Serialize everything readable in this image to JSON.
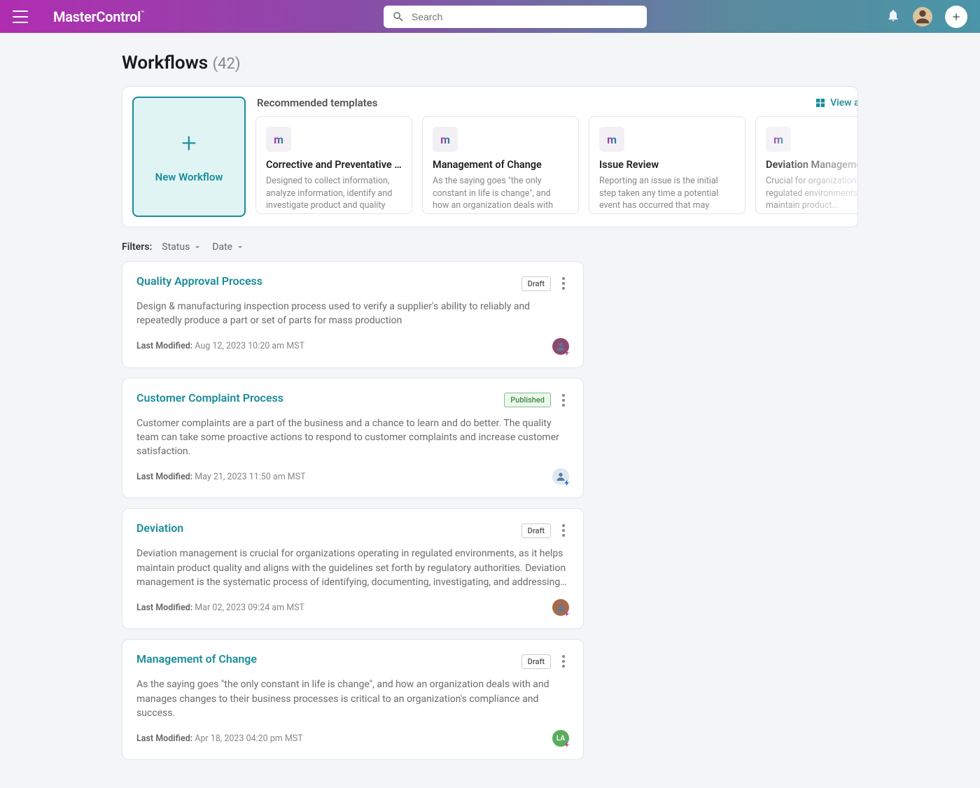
{
  "header": {
    "brand": "MasterControl",
    "search_placeholder": "Search"
  },
  "page": {
    "title": "Workflows",
    "count": "(42)"
  },
  "templates": {
    "section_title": "Recommended templates",
    "view_all": "View all templates",
    "new_workflow_label": "New Workflow",
    "items": [
      {
        "title": "Corrective and Preventative A...",
        "desc": "Designed to collect information, analyze information, identify and investigate product and quality prob..."
      },
      {
        "title": "Management of Change",
        "desc": "As the saying goes \"the only constant in life is change\", and how an organization deals with and manage..."
      },
      {
        "title": "Issue Review",
        "desc": "Reporting an issue is the initial step taken any time a potential event has occurred that may impact the qualit..."
      },
      {
        "title": "Deviation Management",
        "desc": "Crucial for organizations in regulated environments to help maintain product..."
      }
    ]
  },
  "filters": {
    "label": "Filters:",
    "status": "Status",
    "date": "Date"
  },
  "workflows": [
    {
      "title": "Quality Approval Process",
      "status": "Draft",
      "status_class": "",
      "desc": "Design & manufacturing inspection process used to verify a supplier's ability to reliably and repeatedly produce a part or set of parts for mass production",
      "modified_label": "Last Modified:",
      "modified": "Aug 12, 2023 10:20 am MST",
      "avatar_class": "p0",
      "avatar_initials": ""
    },
    {
      "title": "Customer Complaint Process",
      "status": "Published",
      "status_class": "published",
      "desc": "Customer complaints are a part of the business and a chance to learn and do better. The quality team can take some proactive actions to respond to customer complaints and increase customer satisfaction.",
      "modified_label": "Last Modified:",
      "modified": "May 21, 2023 11:50 am MST",
      "avatar_class": "p1",
      "avatar_initials": ""
    },
    {
      "title": "Deviation",
      "status": "Draft",
      "status_class": "",
      "desc": "Deviation management is crucial for organizations operating in regulated environments, as it helps maintain product quality and aligns with the guidelines set forth by regulatory authorities. Deviation management is the systematic process of identifying, documenting, investigating, and addressing any unexpected or unplanned...",
      "modified_label": "Last Modified:",
      "modified": "Mar 02, 2023 09:24 am MST",
      "avatar_class": "p2",
      "avatar_initials": ""
    },
    {
      "title": "Management of Change",
      "status": "Draft",
      "status_class": "",
      "desc": "As the saying goes \"the only constant in life is change\", and how an organization deals with and manages changes to their business processes is critical to an organization's compliance and success.",
      "modified_label": "Last Modified:",
      "modified": "Apr 18, 2023 04:20 pm MST",
      "avatar_class": "p3",
      "avatar_initials": "LA"
    }
  ]
}
